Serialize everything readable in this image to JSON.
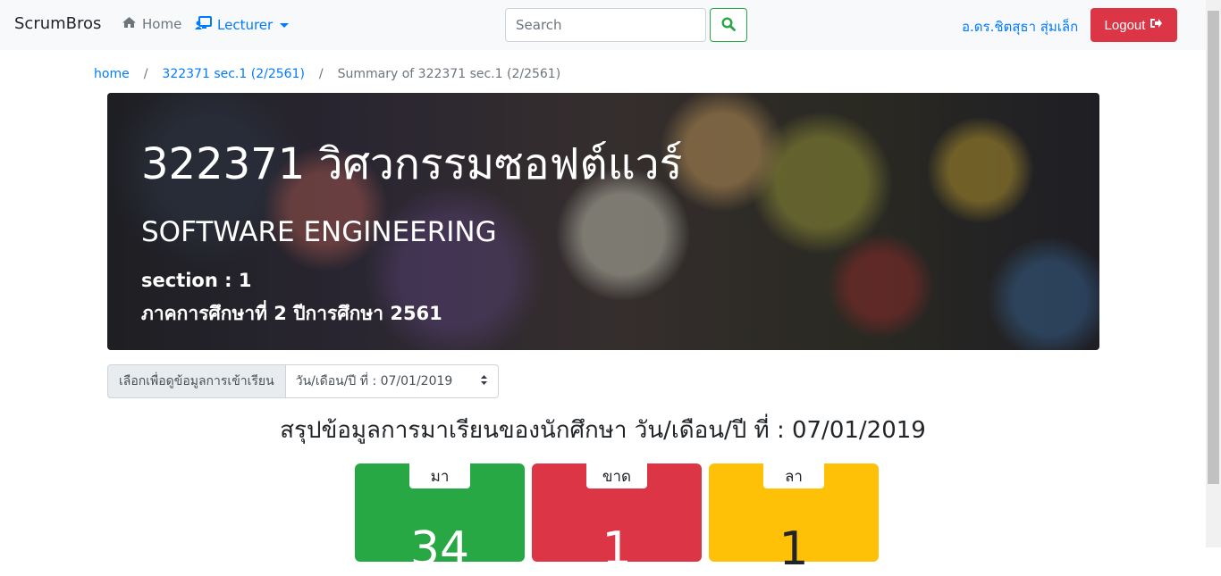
{
  "navbar": {
    "brand": "ScrumBros",
    "home_label": "Home",
    "lecturer_label": "Lecturer",
    "search_placeholder": "Search",
    "user_name": "อ.ดร.ชิตสุธา สุ่มเล็ก",
    "logout_label": "Logout"
  },
  "breadcrumb": {
    "items": [
      "home",
      "322371 sec.1 (2/2561)",
      "Summary of 322371 sec.1 (2/2561)"
    ],
    "separator": "/"
  },
  "hero": {
    "title": "322371 วิศวกรรมซอฟต์แวร์",
    "subtitle": "SOFTWARE ENGINEERING",
    "section": "section : 1",
    "term": "ภาคการศึกษาที่ 2 ปีการศึกษา 2561"
  },
  "attendance_select": {
    "label": "เลือกเพื่อดูข้อมูลการเข้าเรียน",
    "selected": "วัน/เดือน/ปี ที่ : 07/01/2019"
  },
  "summary": {
    "title": "สรุปข้อมูลการมาเรียนของนักศึกษา วัน/เดือน/ปี ที่ : 07/01/2019",
    "cards": [
      {
        "label": "มา",
        "value": "34",
        "color": "#28a745",
        "text_color": "#ffffff"
      },
      {
        "label": "ขาด",
        "value": "1",
        "color": "#dc3545",
        "text_color": "#ffffff"
      },
      {
        "label": "ลา",
        "value": "1",
        "color": "#ffc107",
        "text_color": "#212529"
      }
    ]
  },
  "colors": {
    "primary": "#007bff",
    "success": "#28a745",
    "danger": "#dc3545",
    "warning": "#ffc107"
  },
  "icons": [
    "home-icon",
    "lecturer-icon",
    "search-icon",
    "sign-out-icon"
  ]
}
